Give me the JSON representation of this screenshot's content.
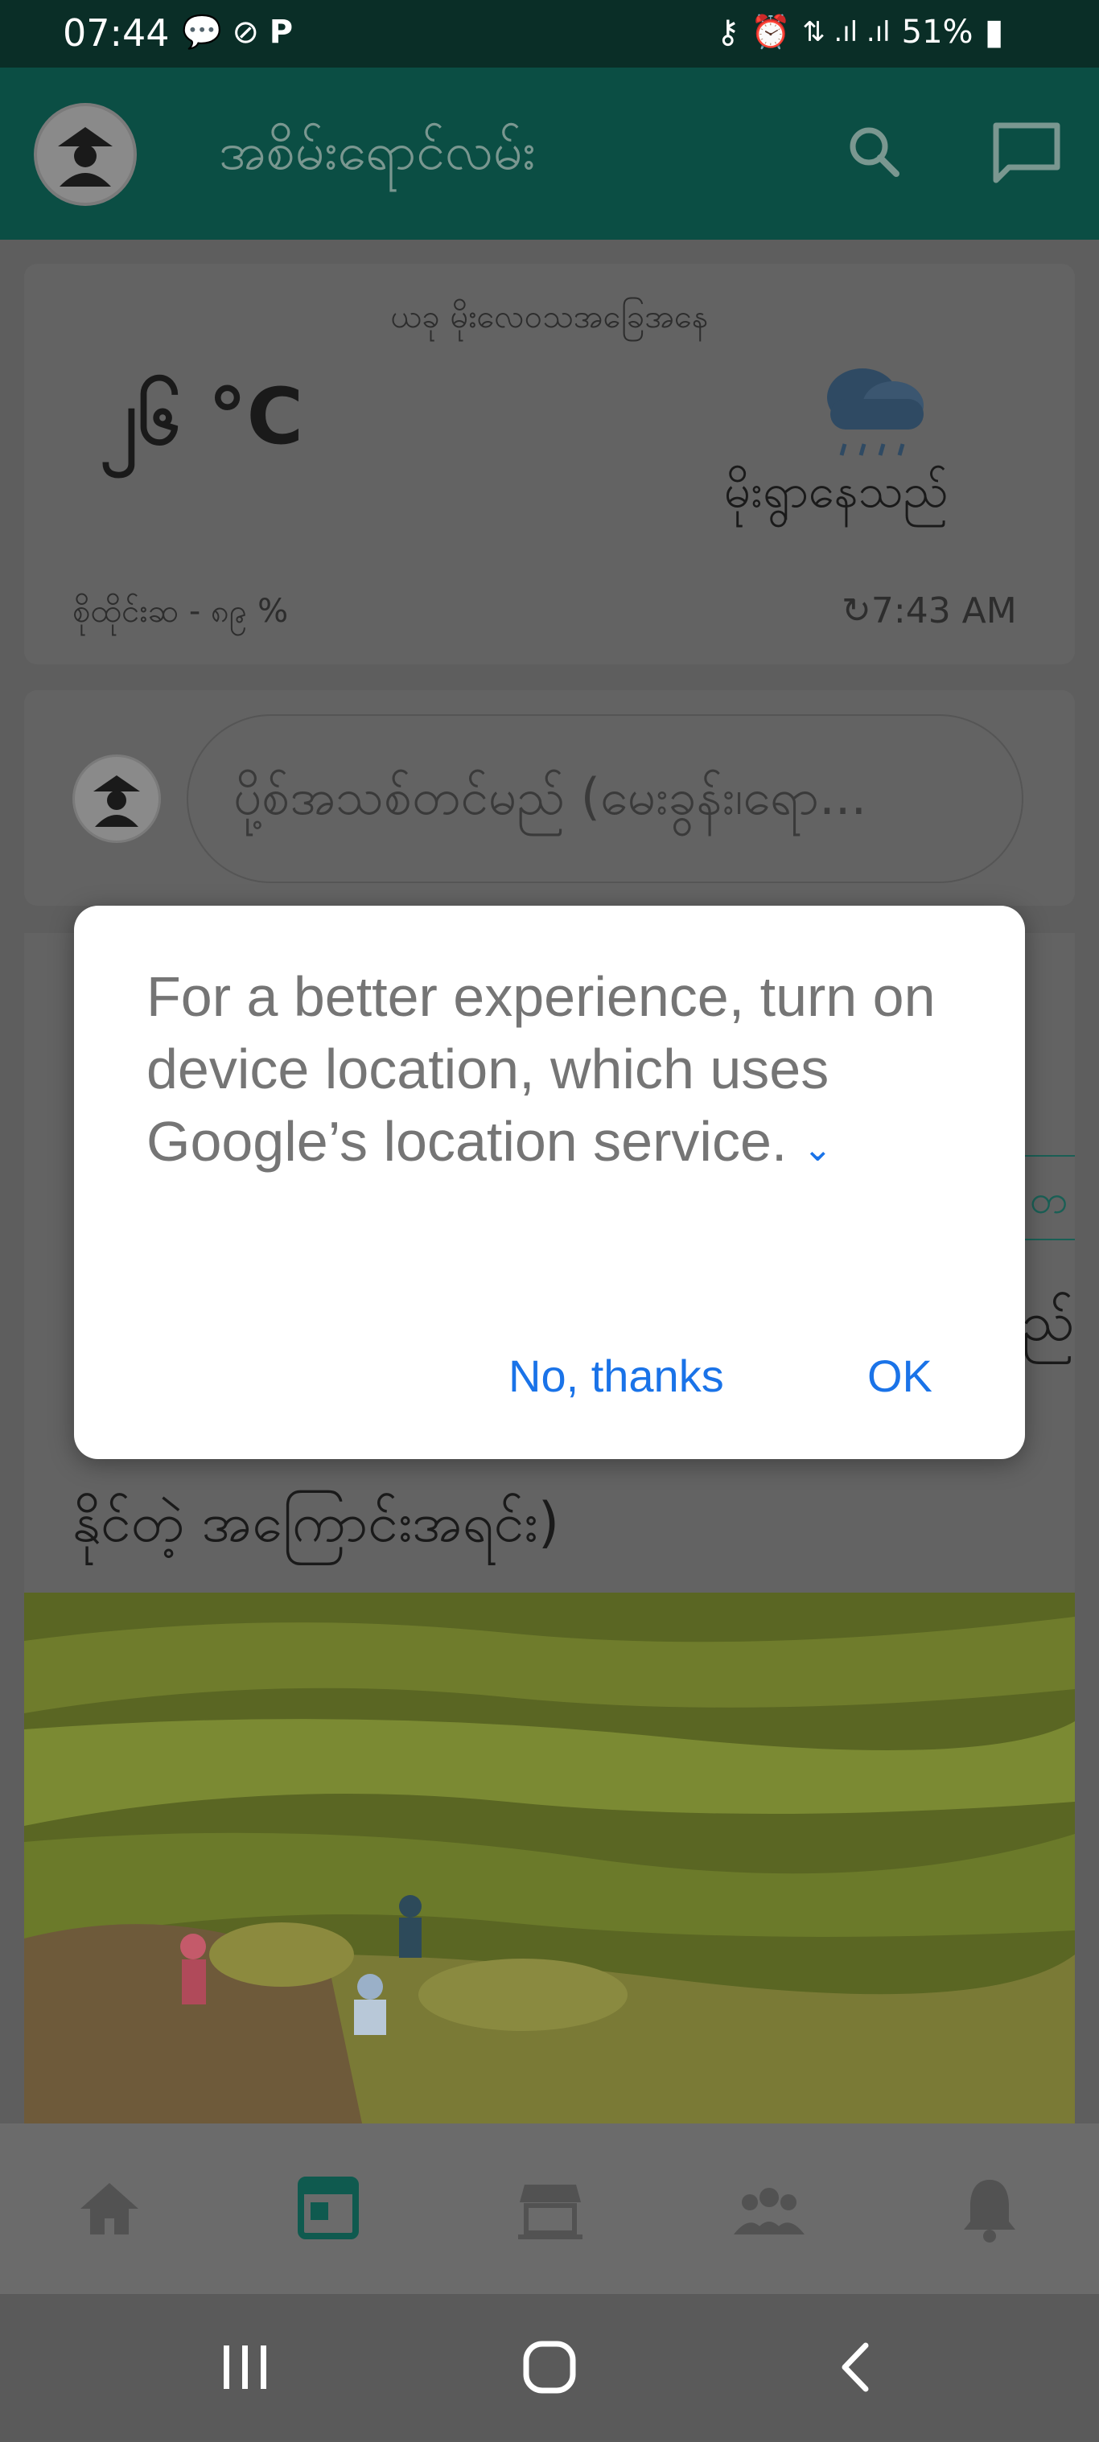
{
  "status_bar": {
    "time": "07:44",
    "battery": "51%"
  },
  "app_bar": {
    "title": "အစိမ်းရောင်လမ်း"
  },
  "weather": {
    "location": "ယခု မိုးလေဝသအခြေအနေ",
    "temperature": "၂၆ °C",
    "condition": "မိုးရွာနေသည်",
    "humidity": "စိုထိုင်းဆ - ၈၉ %",
    "updated": "7:43 AM"
  },
  "post_box": {
    "placeholder": "ပို့စ်အသစ်တင်မည် (မေးခွန်း၊ရော..."
  },
  "article": {
    "tag_fragment": "တ",
    "title_fragment": "ည်",
    "title_visible": "နိုင်တဲ့ အကြောင်းအရင်း)"
  },
  "dialog": {
    "message": "For a better experience, turn on device location, which uses Google’s location service.",
    "negative_label": "No, thanks",
    "positive_label": "OK"
  },
  "bottom_nav": {
    "items": [
      {
        "icon": "home-icon",
        "active": false
      },
      {
        "icon": "feed-icon",
        "active": true
      },
      {
        "icon": "store-icon",
        "active": false
      },
      {
        "icon": "community-icon",
        "active": false
      },
      {
        "icon": "bell-icon",
        "active": false
      }
    ],
    "active_color": "#0f5a4f"
  },
  "colors": {
    "accent": "#1a73e8",
    "brand": "#0b4e44"
  }
}
